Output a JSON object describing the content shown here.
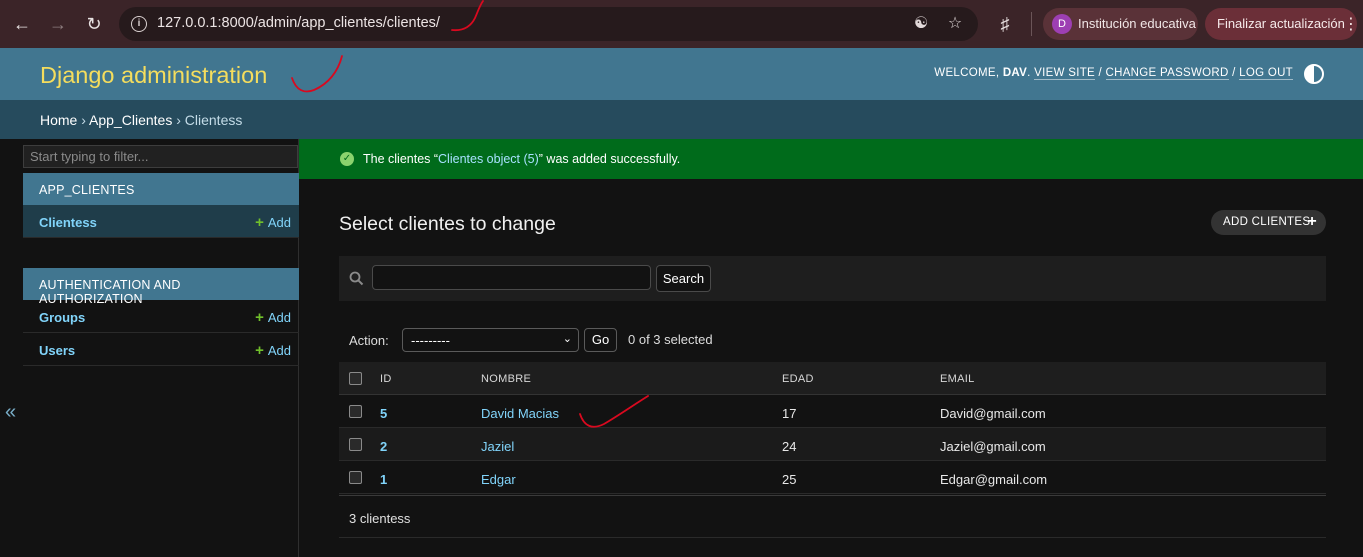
{
  "browser": {
    "url": "127.0.0.1:8000/admin/app_clientes/clientes/",
    "profile_initial": "D",
    "profile_name": "Institución educativa",
    "update_label": "Finalizar actualización"
  },
  "header": {
    "branding": "Django administration",
    "welcome": "WELCOME,",
    "username": "DAV",
    "view_site": "VIEW SITE",
    "change_password": "CHANGE PASSWORD",
    "log_out": "LOG OUT"
  },
  "breadcrumbs": {
    "home": "Home",
    "app": "App_Clientes",
    "model": "Clientess",
    "separator": "›"
  },
  "sidebar": {
    "filter_placeholder": "Start typing to filter...",
    "modules": [
      {
        "caption": "APP_CLIENTES",
        "models": [
          {
            "name": "Clientess",
            "add": "Add"
          }
        ]
      },
      {
        "caption": "AUTHENTICATION AND AUTHORIZATION",
        "models": [
          {
            "name": "Groups",
            "add": "Add"
          },
          {
            "name": "Users",
            "add": "Add"
          }
        ]
      }
    ],
    "collapse_glyph": "«"
  },
  "message": {
    "prefix": "The clientes “",
    "link": "Clientes object (5)",
    "suffix": "” was added successfully."
  },
  "content": {
    "title": "Select clientes to change",
    "add_button": "ADD CLIENTES",
    "search_button": "Search",
    "action_label": "Action:",
    "action_selected": "---------",
    "go_button": "Go",
    "action_counter": "0 of 3 selected",
    "columns": [
      "ID",
      "NOMBRE",
      "EDAD",
      "EMAIL"
    ],
    "rows": [
      {
        "id": "5",
        "nombre": "David Macias",
        "edad": "17",
        "email": "David@gmail.com"
      },
      {
        "id": "2",
        "nombre": "Jaziel",
        "edad": "24",
        "email": "Jaziel@gmail.com"
      },
      {
        "id": "1",
        "nombre": "Edgar",
        "edad": "25",
        "email": "Edgar@gmail.com"
      }
    ],
    "paginator": "3 clientess"
  },
  "colors": {
    "header_bg": "#417690",
    "branding": "#f5dd5d",
    "breadcrumbs_bg": "#264b5d",
    "success_bg": "#006b1b",
    "link": "#81d4fa",
    "annotation": "#d9091f"
  }
}
